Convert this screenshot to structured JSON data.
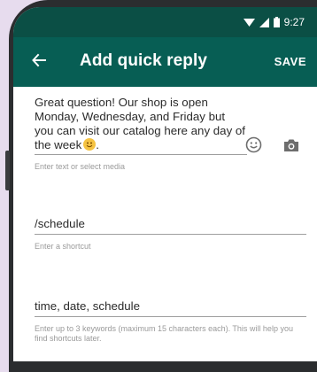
{
  "status_bar": {
    "time": "9:27"
  },
  "toolbar": {
    "title": "Add quick reply",
    "save_label": "SAVE"
  },
  "message": {
    "text": "Great question! Our shop is open Monday, Wednesday, and Friday but you can visit our catalog here any day of the week",
    "helper": "Enter text or select media"
  },
  "shortcut": {
    "value": "/schedule",
    "helper": "Enter a shortcut"
  },
  "keywords": {
    "value": "time, date, schedule",
    "helper": "Enter up to 3 keywords (maximum 15 characters each). This will help you find shortcuts later."
  },
  "icons": {
    "back": "arrow-left-icon",
    "emoji": "smiley-icon",
    "camera": "camera-icon",
    "wifi": "wifi-icon",
    "signal": "signal-icon",
    "battery": "battery-icon"
  },
  "colors": {
    "toolbar": "#075e54",
    "statusbar": "#0b4f45",
    "background": "#e7dcee"
  }
}
